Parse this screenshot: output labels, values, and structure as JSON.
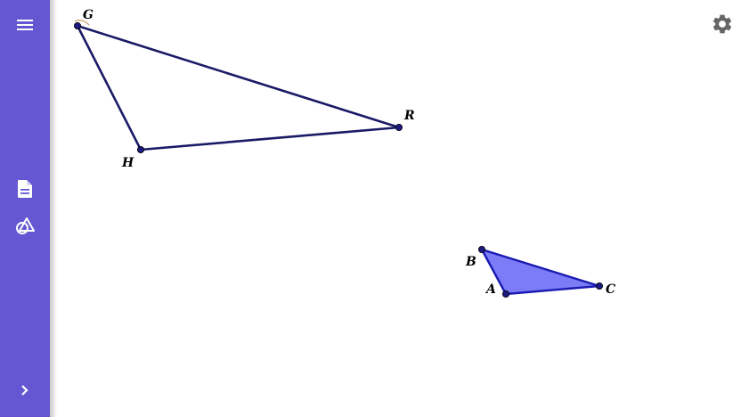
{
  "toolbar": {
    "menu_icon": "hamburger-menu-icon",
    "tools": [
      "document-icon",
      "shapes-tool-icon"
    ],
    "expand_icon": "chevron-right-icon",
    "accent_color": "#6557d2"
  },
  "settings": {
    "icon": "gear-icon"
  },
  "canvas": {
    "points": {
      "G": "G",
      "H": "H",
      "R": "R",
      "A": "A",
      "B": "B",
      "C": "C"
    },
    "triangle_GHR": {
      "stroke": "#1a1a66",
      "fill": "none",
      "vertices": [
        "G",
        "H",
        "R"
      ]
    },
    "triangle_ABC": {
      "stroke": "#1a1ab4",
      "fill": "#7c7cf6",
      "vertices": [
        "A",
        "B",
        "C"
      ]
    }
  }
}
